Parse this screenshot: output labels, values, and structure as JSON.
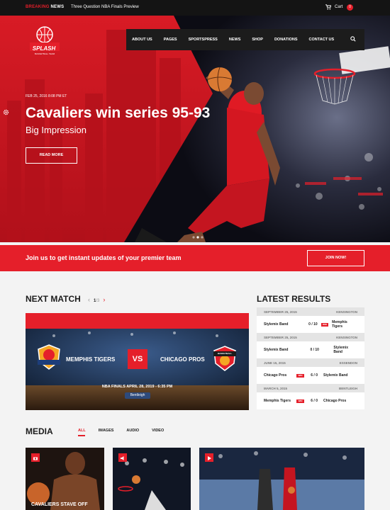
{
  "topbar": {
    "breaking_red": "BREAKING",
    "breaking_white": "NEWS",
    "ticker": "Three Question NBA Finals Preview",
    "cart_label": "Cart",
    "cart_count": "0"
  },
  "logo": {
    "name": "SPLASH",
    "tagline": "BASKETBALL TEAM"
  },
  "nav": {
    "items": [
      "ABOUT US",
      "PAGES",
      "SPORTSPRESS",
      "NEWS",
      "SHOP",
      "DONATIONS",
      "CONTACT US"
    ]
  },
  "hero": {
    "date": "FEB 25, 2016 8:08 PM ET",
    "title": "Cavaliers win series 95-93",
    "subtitle": "Big Impression",
    "button": "READ MORE"
  },
  "join": {
    "text": "Join us to get instant updates of your premier team",
    "button": "JOIN NOW!"
  },
  "next_match": {
    "heading": "NEXT MATCH",
    "page_current": "1",
    "page_sep": "/",
    "page_total": "3",
    "team1": "MEMPHIS TIGERS",
    "vs": "VS",
    "team2": "CHICAGO PROS",
    "date": "NBA FINALS APRIL 28, 2019 - 6:35 PM",
    "venue": "Bentleigh",
    "badge_text": "BASKETBALL"
  },
  "results": {
    "heading": "LATEST RESULTS",
    "items": [
      {
        "date": "SEPTEMBER 25, 2015",
        "venue": "KENSINGTON",
        "home": "Stylemix Band",
        "score": "0 / 10",
        "win": "WIN",
        "away": "Memphis Tigers"
      },
      {
        "date": "SEPTEMBER 25, 2015",
        "venue": "KENSINGTON",
        "home": "Stylemix Band",
        "score": "0 / 10",
        "win": "",
        "away": "Stylemix Band"
      },
      {
        "date": "JUNE 15, 2015",
        "venue": "ESSENDON",
        "home": "Chicago Pros",
        "score": "6 / 0",
        "win": "WIN",
        "away": "Stylemix Band"
      },
      {
        "date": "MARCH 5, 2015",
        "venue": "BENTLEIGH",
        "home": "Memphis Tigers",
        "score": "6 / 0",
        "win": "WIN",
        "away": "Chicago Pros"
      }
    ]
  },
  "media": {
    "heading": "MEDIA",
    "tabs": [
      "ALL",
      "IMAGES",
      "AUDIO",
      "VIDEO"
    ],
    "caption1": "CAVALIERS STAVE OFF"
  },
  "colors": {
    "accent": "#e51f2a",
    "dark": "#141414"
  }
}
